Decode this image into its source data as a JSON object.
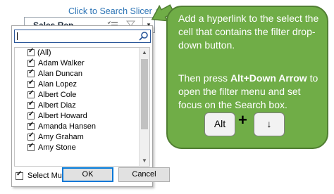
{
  "link": {
    "text": "Click to Search Slicer",
    "arrow": "↓"
  },
  "slicer": {
    "title": "Sales Rep",
    "icons": [
      "multi-select-icon",
      "clear-filter-icon"
    ],
    "dropdown_icon": "▾"
  },
  "filter_menu": {
    "search_placeholder": "",
    "items": [
      {
        "label": "(All)",
        "checked": true
      },
      {
        "label": "Adam Walker",
        "checked": true
      },
      {
        "label": "Alan Duncan",
        "checked": true
      },
      {
        "label": "Alan Lopez",
        "checked": true
      },
      {
        "label": "Albert Cole",
        "checked": true
      },
      {
        "label": "Albert Diaz",
        "checked": true
      },
      {
        "label": "Albert Howard",
        "checked": true
      },
      {
        "label": "Amanda Hansen",
        "checked": true
      },
      {
        "label": "Amy Graham",
        "checked": true
      },
      {
        "label": "Amy Stone",
        "checked": true
      }
    ],
    "select_multiple_label": "Select Multiple Items",
    "ok_label": "OK",
    "cancel_label": "Cancel"
  },
  "callout": {
    "text1": "Add a hyperlink to the select the cell that contains the filter drop-down button.",
    "text2_prefix": "Then press ",
    "text2_bold": "Alt+Down Arrow",
    "text2_suffix": " to open the filter menu and set focus on the Search box.",
    "key1": "Alt",
    "plus": "+",
    "key2": "↓",
    "color": "#70ad47"
  }
}
